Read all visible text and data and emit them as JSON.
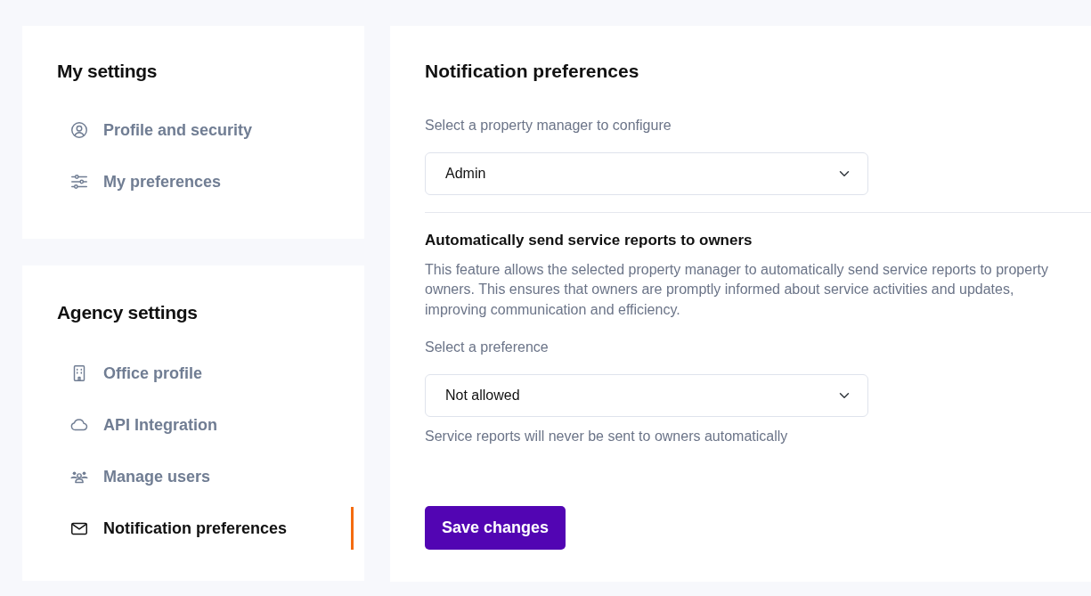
{
  "sidebar": [
    {
      "title": "My settings",
      "items": [
        {
          "kind": "person",
          "label": "Profile and security",
          "selected": false
        },
        {
          "kind": "sliders",
          "label": "My preferences",
          "selected": false
        }
      ]
    },
    {
      "title": "Agency settings",
      "items": [
        {
          "kind": "building",
          "label": "Office profile",
          "selected": false
        },
        {
          "kind": "cloud",
          "label": "API Integration",
          "selected": false
        },
        {
          "kind": "people",
          "label": "Manage users",
          "selected": false
        },
        {
          "kind": "envelope",
          "label": "Notification preferences",
          "selected": true
        }
      ]
    }
  ],
  "main": {
    "title": "Notification preferences",
    "manager_label": "Select a property manager to configure",
    "manager_value": "Admin",
    "section_title": "Automatically send service reports to owners",
    "section_text": "This feature allows the selected property manager to automatically send service reports to property owners. This ensures that owners are promptly informed about service activities and updates, improving communication and efficiency.",
    "preference_label": "Select a preference",
    "preference_value": "Not allowed",
    "preference_hint": "Service reports will never be sent to owners automatically",
    "save_button": "Save changes"
  }
}
